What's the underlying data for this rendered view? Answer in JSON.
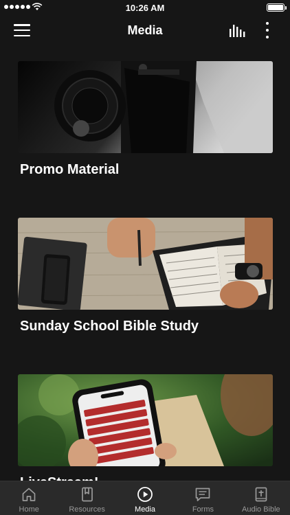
{
  "status": {
    "time": "10:26 AM"
  },
  "nav": {
    "title": "Media",
    "menu_icon": "hamburger-menu-icon",
    "audio_icon": "equalizer-icon",
    "more_icon": "more-vertical-icon"
  },
  "cards": [
    {
      "title": "Promo Material",
      "image": "camera-photo"
    },
    {
      "title": "Sunday School Bible Study",
      "image": "bible-study-photo"
    },
    {
      "title": "LiveStream!",
      "image": "phone-app-photo"
    }
  ],
  "tabs": [
    {
      "label": "Home",
      "icon": "home-icon",
      "active": false
    },
    {
      "label": "Resources",
      "icon": "bookmark-book-icon",
      "active": false
    },
    {
      "label": "Media",
      "icon": "play-circle-icon",
      "active": true
    },
    {
      "label": "Forms",
      "icon": "form-message-icon",
      "active": false
    },
    {
      "label": "Audio Bible",
      "icon": "bible-cross-icon",
      "active": false
    }
  ],
  "colors": {
    "background": "#161616",
    "tabbar": "#2a2a2a",
    "active": "#ffffff",
    "inactive": "#9a9a9a"
  }
}
